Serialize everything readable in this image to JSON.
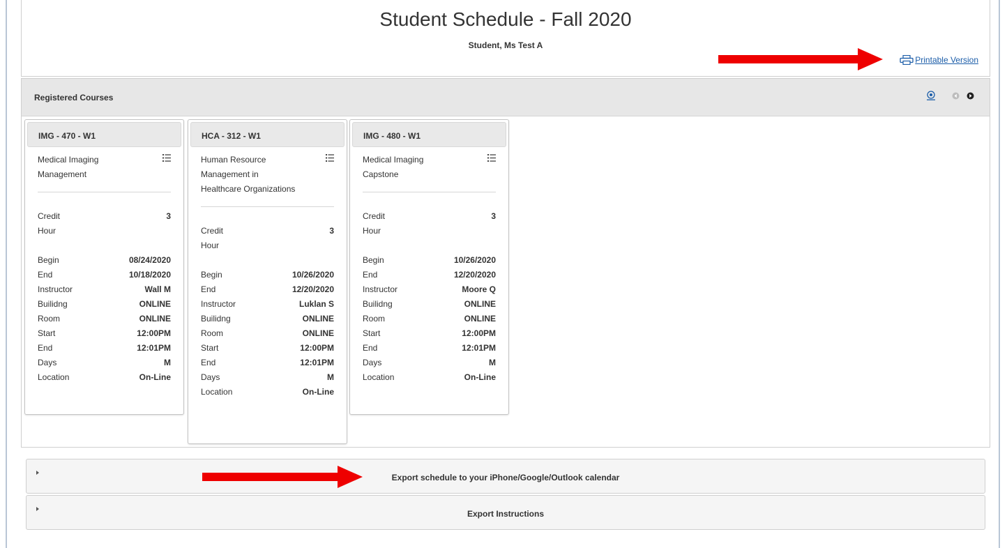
{
  "header": {
    "title": "Student Schedule - Fall 2020",
    "student": "Student, Ms Test A",
    "printable_label": "Printable Version"
  },
  "courses_panel": {
    "title": "Registered Courses"
  },
  "courses": [
    {
      "code": "IMG - 470 - W1",
      "title": "Medical Imaging Management",
      "credit_label": "Credit Hour",
      "credit": "3",
      "details": [
        {
          "label": "Begin",
          "value": "08/24/2020"
        },
        {
          "label": "End",
          "value": "10/18/2020"
        },
        {
          "label": "Instructor",
          "value": "Wall M"
        },
        {
          "label": "Builidng",
          "value": "ONLINE"
        },
        {
          "label": "Room",
          "value": "ONLINE"
        },
        {
          "label": "Start",
          "value": "12:00PM"
        },
        {
          "label": "End",
          "value": "12:01PM"
        },
        {
          "label": "Days",
          "value": "M"
        },
        {
          "label": "Location",
          "value": "On-Line"
        }
      ]
    },
    {
      "code": "HCA - 312 - W1",
      "title": "Human Resource Management in Healthcare Organizations",
      "credit_label": "Credit Hour",
      "credit": "3",
      "details": [
        {
          "label": "Begin",
          "value": "10/26/2020"
        },
        {
          "label": "End",
          "value": "12/20/2020"
        },
        {
          "label": "Instructor",
          "value": "Luklan S"
        },
        {
          "label": "Builidng",
          "value": "ONLINE"
        },
        {
          "label": "Room",
          "value": "ONLINE"
        },
        {
          "label": "Start",
          "value": "12:00PM"
        },
        {
          "label": "End",
          "value": "12:01PM"
        },
        {
          "label": "Days",
          "value": "M"
        },
        {
          "label": "Location",
          "value": "On-Line"
        }
      ]
    },
    {
      "code": "IMG - 480 - W1",
      "title": "Medical Imaging Capstone",
      "credit_label": "Credit Hour",
      "credit": "3",
      "details": [
        {
          "label": "Begin",
          "value": "10/26/2020"
        },
        {
          "label": "End",
          "value": "12/20/2020"
        },
        {
          "label": "Instructor",
          "value": "Moore Q"
        },
        {
          "label": "Builidng",
          "value": "ONLINE"
        },
        {
          "label": "Room",
          "value": "ONLINE"
        },
        {
          "label": "Start",
          "value": "12:00PM"
        },
        {
          "label": "End",
          "value": "12:01PM"
        },
        {
          "label": "Days",
          "value": "M"
        },
        {
          "label": "Location",
          "value": "On-Line"
        }
      ]
    }
  ],
  "accordions": [
    {
      "label": "Export schedule to your iPhone/Google/Outlook calendar"
    },
    {
      "label": "Export Instructions"
    }
  ],
  "colors": {
    "annotation_arrow": "#ee0000",
    "link": "#1a5ca8",
    "panel_header": "#e7e7e7"
  }
}
